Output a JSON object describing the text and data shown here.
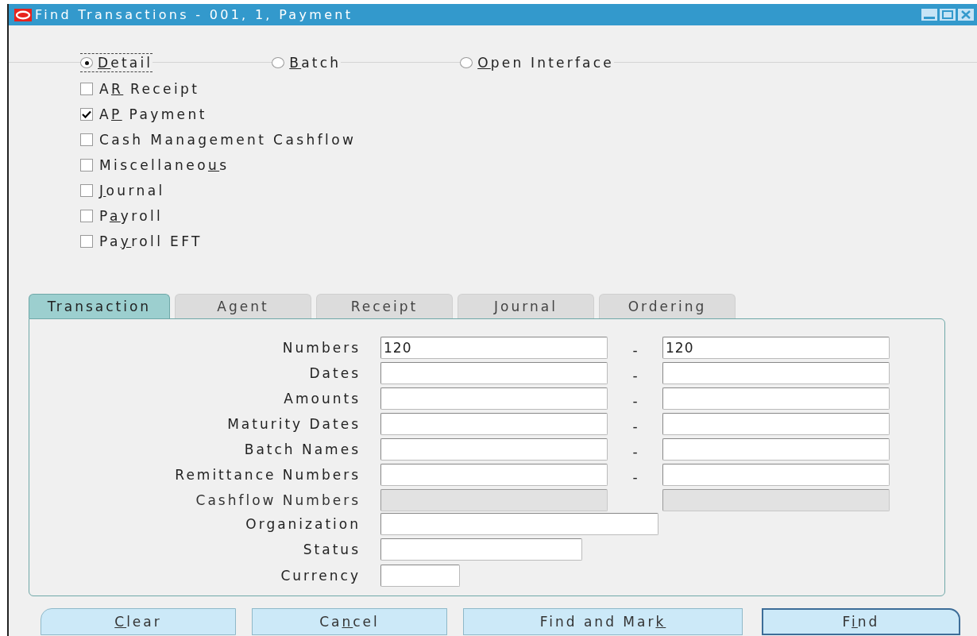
{
  "window": {
    "title": "Find Transactions - 001, 1, Payment"
  },
  "modes": [
    {
      "key": "D",
      "after": "etail",
      "selected": true
    },
    {
      "key": "B",
      "after": "atch",
      "selected": false
    },
    {
      "key": "O",
      "after": "pen Interface",
      "selected": false
    }
  ],
  "sources": [
    {
      "before": "A",
      "key": "R",
      "after": " Receipt",
      "checked": false
    },
    {
      "before": "A",
      "key": "P",
      "after": " Payment",
      "checked": true
    },
    {
      "before": "Cash Management Cashflow",
      "checked": false
    },
    {
      "before": "Miscellaneo",
      "key": "u",
      "after": "s",
      "checked": false
    },
    {
      "key": "J",
      "after": "ournal",
      "checked": false
    },
    {
      "before": "P",
      "key": "a",
      "after": "yroll",
      "checked": false
    },
    {
      "before": "Pa",
      "key": "y",
      "after": "roll EFT",
      "checked": false
    }
  ],
  "tabs": [
    {
      "label": "Transaction",
      "selected": true
    },
    {
      "label": "Agent",
      "selected": false
    },
    {
      "label": "Receipt",
      "selected": false
    },
    {
      "label": "Journal",
      "selected": false
    },
    {
      "label": "Ordering",
      "selected": false
    }
  ],
  "fields": [
    {
      "label": "Numbers",
      "kind": "range",
      "from": "120",
      "separator": "-",
      "to": "120",
      "disabled": false
    },
    {
      "label": "Dates",
      "kind": "range",
      "separator": "-",
      "disabled": false
    },
    {
      "label": "Amounts",
      "kind": "range",
      "separator": "-",
      "disabled": false
    },
    {
      "label": "Maturity Dates",
      "kind": "range",
      "separator": "-",
      "disabled": false
    },
    {
      "label": "Batch Names",
      "kind": "range",
      "separator": "-",
      "disabled": false
    },
    {
      "label": "Remittance Numbers",
      "kind": "range",
      "separator": "-",
      "disabled": false
    },
    {
      "label": "Cashflow Numbers",
      "kind": "range",
      "disabled": true
    },
    {
      "label": "Organization",
      "kind": "long",
      "disabled": false
    },
    {
      "label": "Status",
      "kind": "medium",
      "disabled": false
    },
    {
      "label": "Currency",
      "kind": "short",
      "disabled": false
    }
  ],
  "buttons": [
    {
      "key": "C",
      "after": "lear",
      "kind": "first"
    },
    {
      "before": "Ca",
      "key": "n",
      "after": "cel",
      "kind": "plain"
    },
    {
      "before": "Find and Mar",
      "key": "k",
      "kind": "plain"
    },
    {
      "before": "F",
      "key": "i",
      "after": "nd",
      "kind": "default"
    }
  ]
}
